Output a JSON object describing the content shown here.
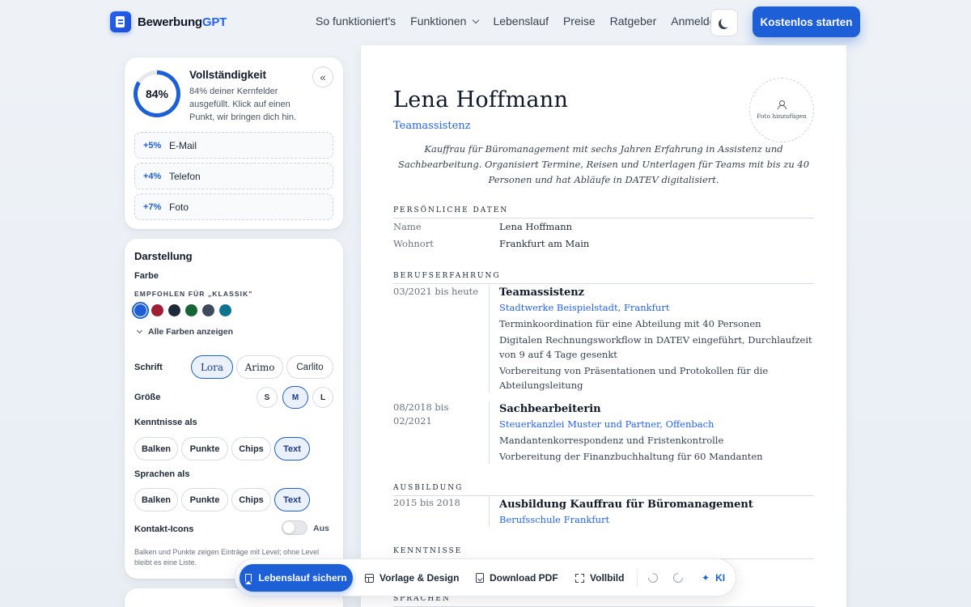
{
  "nav": {
    "logo_main": "Bewerbung",
    "logo_accent": "GPT",
    "items": [
      "So funktioniert's",
      "Funktionen",
      "Lebenslauf",
      "Preise",
      "Ratgeber",
      "Anmelden"
    ],
    "cta": "Kostenlos starten"
  },
  "completeness": {
    "percent_label": "84%",
    "percent_value": 84,
    "title": "Vollständigkeit",
    "text": "84% deiner Kernfelder ausgefüllt. Klick auf einen Punkt, wir bringen dich hin.",
    "suggestions": [
      {
        "pct": "+5%",
        "label": "E-Mail"
      },
      {
        "pct": "+4%",
        "label": "Telefon"
      },
      {
        "pct": "+7%",
        "label": "Foto"
      }
    ]
  },
  "display": {
    "title": "Darstellung",
    "color_label": "Farbe",
    "recommended_caption": "EMPFOHLEN FÜR „KLASSIK\"",
    "swatches": [
      "#1d5fd6",
      "#9f1d35",
      "#1f2937",
      "#166534",
      "#3f4a5c",
      "#0e7490"
    ],
    "more_colors": "Alle Farben anzeigen",
    "font_label": "Schrift",
    "fonts": [
      "Lora",
      "Arimo",
      "Carlito"
    ],
    "size_label": "Größe",
    "sizes": [
      "S",
      "M",
      "L"
    ],
    "skills_label": "Kenntnisse als",
    "skills_options": [
      "Balken",
      "Punkte",
      "Chips",
      "Text"
    ],
    "languages_label": "Sprachen als",
    "languages_options": [
      "Balken",
      "Punkte",
      "Chips",
      "Text"
    ],
    "contact_icons_label": "Kontakt-Icons",
    "contact_icons_state": "Aus",
    "note": "Balken und Punkte zeigen Einträge mit Level; ohne Level bleibt es eine Liste."
  },
  "resume": {
    "name": "Lena Hoffmann",
    "role": "Teamassistenz",
    "photo_label": "Foto hinzufügen",
    "summary": "Kauffrau für Büromanagement mit sechs Jahren Erfahrung in Assistenz und Sachbearbeitung. Organisiert Termine, Reisen und Unterlagen für Teams mit bis zu 40 Personen und hat Abläufe in DATEV digitalisiert.",
    "sections": {
      "personal": "PERSÖNLICHE DATEN",
      "experience": "BERUFSERFAHRUNG",
      "education": "AUSBILDUNG",
      "skills": "KENNTNISSE",
      "languages": "SPRACHEN"
    },
    "personal": [
      {
        "key": "Name",
        "value": "Lena Hoffmann"
      },
      {
        "key": "Wohnort",
        "value": "Frankfurt am Main"
      }
    ],
    "experience": [
      {
        "date": "03/2021 bis heute",
        "title": "Teamassistenz",
        "org": "Stadtwerke Beispielstadt, Frankfurt",
        "lines": [
          "Terminkoordination für eine Abteilung mit 40 Personen",
          "Digitalen Rechnungsworkflow in DATEV eingeführt, Durchlaufzeit von 9 auf 4 Tage gesenkt",
          "Vorbereitung von Präsentationen und Protokollen für die Abteilungsleitung"
        ]
      },
      {
        "date_from": "08/2018 bis",
        "date_to": "02/2021",
        "title": "Sachbearbeiterin",
        "org": "Steuerkanzlei Muster und Partner, Offenbach",
        "lines": [
          "Mandantenkorrespondenz und Fristenkontrolle",
          "Vorbereitung der Finanzbuchhaltung für 60 Mandanten"
        ]
      }
    ],
    "education": [
      {
        "date": "2015 bis 2018",
        "title": "Ausbildung Kauffrau für Büromanagement",
        "org": "Berufsschule Frankfurt"
      }
    ]
  },
  "toolbar": {
    "save": "Lebenslauf sichern",
    "template": "Vorlage & Design",
    "download": "Download PDF",
    "fullscreen": "Vollbild",
    "ai": "KI"
  }
}
